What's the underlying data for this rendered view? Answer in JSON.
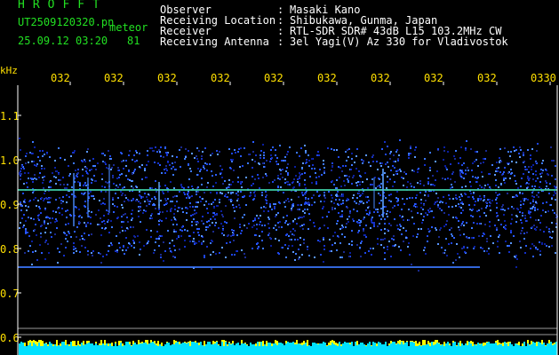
{
  "header": {
    "app_title": "HROFFT",
    "filename": "UT2509120320.pn",
    "mode": "meteor",
    "datetime": "25.09.12 03:20",
    "count": "81"
  },
  "info": [
    {
      "label": "Observer",
      "value": "Masaki Kano"
    },
    {
      "label": "Receiving Location",
      "value": "Shibukawa, Gunma, Japan"
    },
    {
      "label": "Receiver",
      "value": "RTL-SDR SDR# 43dB L15 103.2MHz CW"
    },
    {
      "label": "Receiving Antenna",
      "value": "3el Yagi(V) Az 330 for Vladivostok"
    }
  ],
  "axis": {
    "y_unit": "kHz",
    "y_ticks": [
      "1.1",
      "1.0",
      "0.9",
      "0.8",
      "0.7",
      "0.6"
    ],
    "x_ticks": [
      "032",
      "032",
      "032",
      "032",
      "032",
      "032",
      "032",
      "032",
      "032",
      "0330"
    ]
  },
  "colors": {
    "header_green": "#22e022",
    "tick_yellow": "#ffe000",
    "carrier_line": "#3cc8a0",
    "lower_line": "#3c78ff",
    "activity_yellow": "#ffff00",
    "activity_cyan": "#00e0ff"
  }
}
